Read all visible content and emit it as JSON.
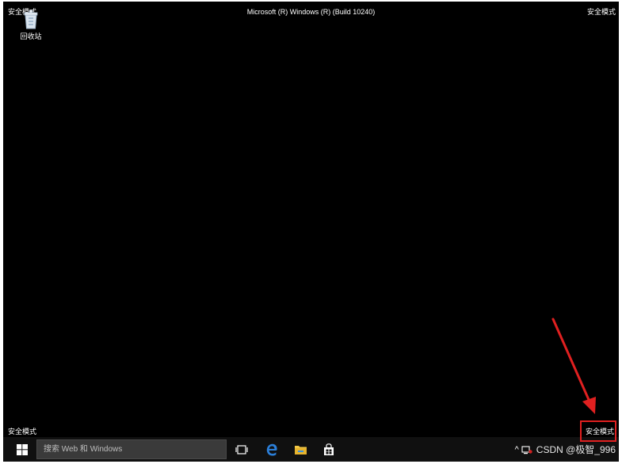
{
  "desktop": {
    "watermark_top_left": "安全模式",
    "watermark_top_right": "安全模式",
    "watermark_top_center": "Microsoft (R) Windows (R) (Build 10240)",
    "watermark_bottom_left": "安全模式",
    "watermark_bottom_right": "安全模式",
    "recycle_bin_label": "回收站"
  },
  "taskbar": {
    "search_placeholder": "搜索 Web 和 Windows",
    "tray_chevron": "^",
    "watermark_text": "CSDN @极智_996"
  },
  "icons": {
    "recycle_bin": "recycle-bin-icon",
    "start": "windows-start-icon",
    "task_view": "task-view-icon",
    "edge": "edge-browser-icon",
    "file_explorer": "file-explorer-icon",
    "store": "store-icon",
    "network": "network-icon"
  },
  "colors": {
    "desktop_bg": "#000000",
    "taskbar_bg": "#101010",
    "highlight": "#e02020",
    "edge_blue": "#2b7fd9",
    "explorer_yellow": "#f2c744"
  }
}
